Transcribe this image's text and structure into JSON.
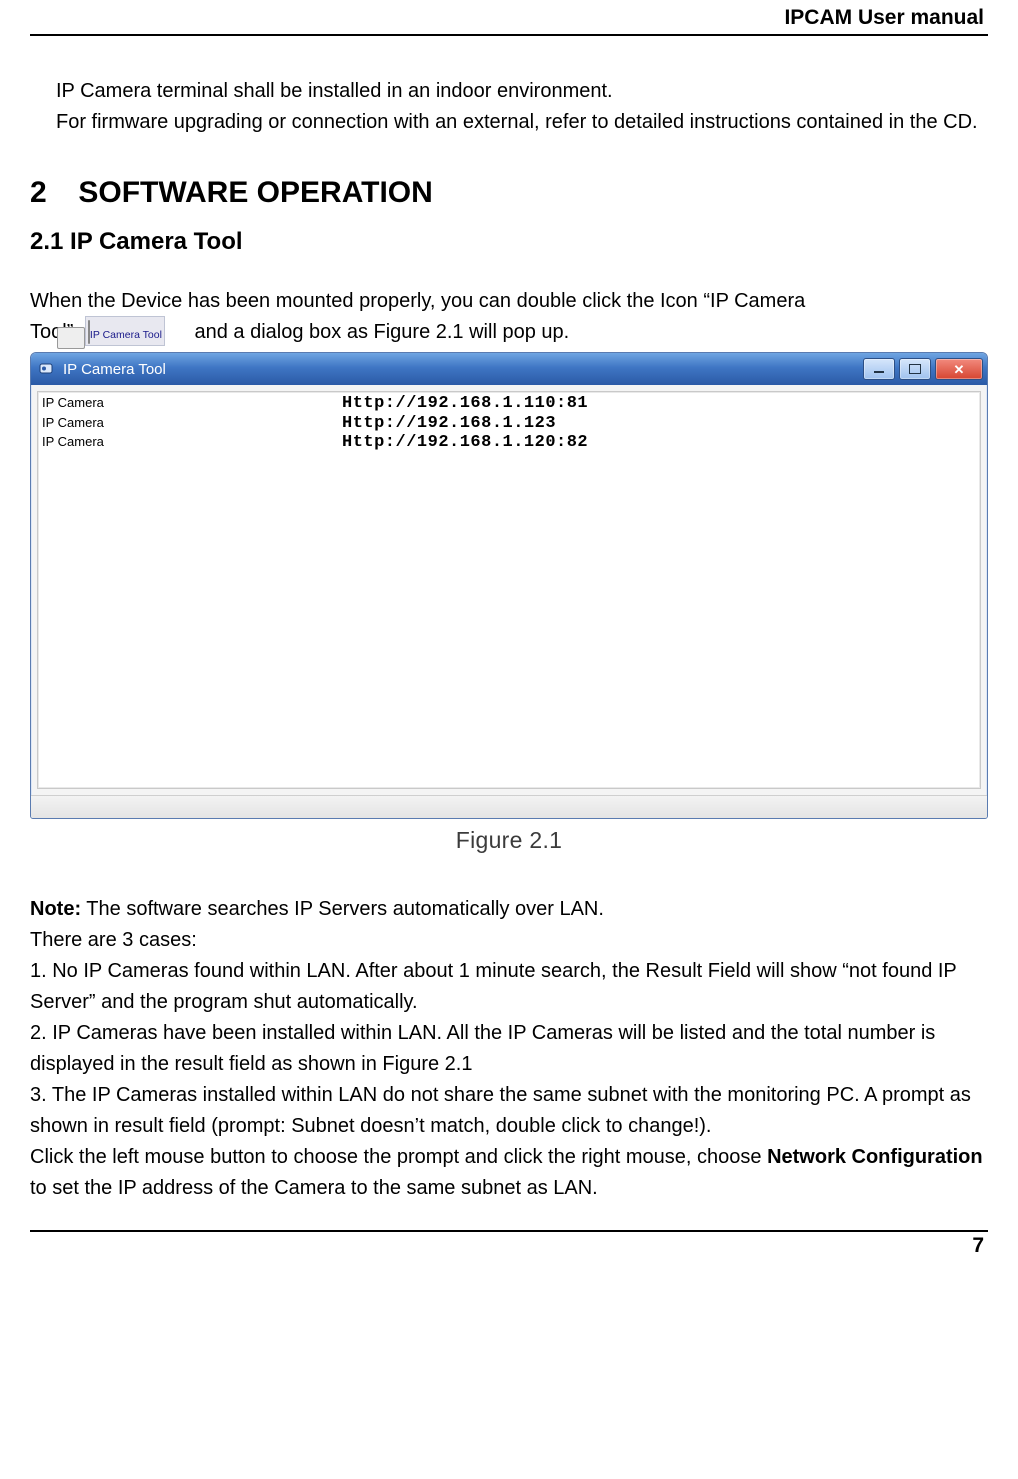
{
  "header": {
    "title": "IPCAM User manual"
  },
  "intro": {
    "line1": "IP Camera terminal shall be installed in an indoor environment.",
    "line2": "For firmware upgrading or connection with an external, refer to detailed instructions contained in the CD."
  },
  "section": {
    "num": "2",
    "title": "SOFTWARE OPERATION",
    "sub_num": "2.1",
    "sub_title": "IP Camera Tool"
  },
  "para1": {
    "pre": "When the Device has been mounted properly, you can double click the Icon “IP Camera",
    "tool_word": "Tool”",
    "post": "and a dialog box as Figure 2.1 will pop up."
  },
  "desktop_icon": {
    "label": "IP Camera Tool"
  },
  "window": {
    "title": "IP Camera Tool",
    "rows": [
      {
        "name": "IP Camera",
        "url": "Http://192.168.1.110:81"
      },
      {
        "name": "IP Camera",
        "url": "Http://192.168.1.123"
      },
      {
        "name": "IP Camera",
        "url": "Http://192.168.1.120:82"
      }
    ]
  },
  "figure_caption": "Figure 2.1",
  "note": {
    "label": "Note:",
    "intro": " The software searches IP Servers automatically over LAN.",
    "cases_header": "There are 3 cases:",
    "case1": "1. No IP Cameras found within LAN. After about 1 minute search, the Result Field will show “not found IP Server” and the program shut automatically.",
    "case2": "2. IP Cameras have been installed within LAN. All the IP Cameras will be listed and the total number is displayed in the result field as shown in Figure 2.1",
    "case3": "3. The IP Cameras installed within LAN do not share the same subnet with the monitoring PC. A prompt as shown in result field (prompt: Subnet doesn’t match, double click to change!).",
    "closing_pre": "Click the left mouse button to choose the prompt and click the right mouse, choose ",
    "closing_bold": "Network Configuration",
    "closing_post": " to set the IP address of the Camera to the same subnet as LAN."
  },
  "page_number": "7"
}
